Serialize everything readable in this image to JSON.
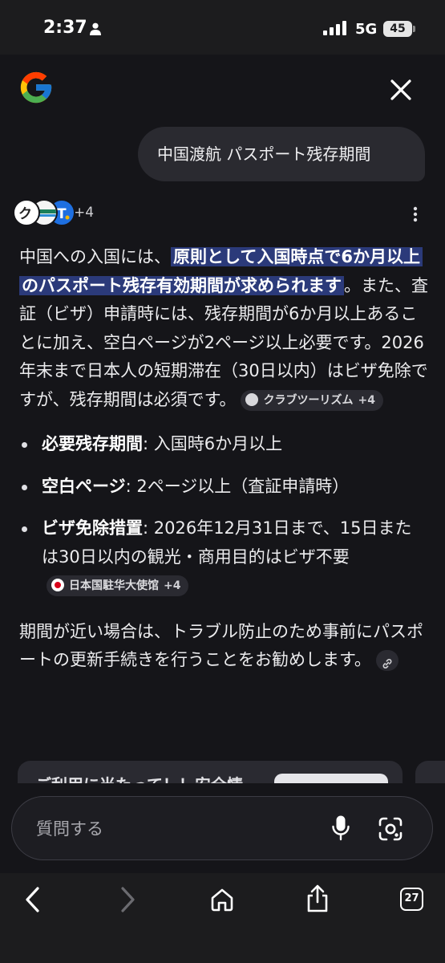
{
  "status_bar": {
    "time": "2:37",
    "network": "5G",
    "battery": "45"
  },
  "query": "中国渡航 パスポート残存期間",
  "sources": {
    "count_label": "+4",
    "icons": [
      "kura-ten-icon",
      "travel-site-icon",
      "t-site-icon"
    ]
  },
  "answer": {
    "intro_before": "中国への入国には、",
    "intro_highlight": "原則として入国時点で6か月以上のパスポート残存有効期間が求められます",
    "intro_after": "。また、査証（ビザ）申請時には、残存期間が6か月以上あることに加え、空白ページが2ページ以上必要です。2026年末まで日本人の短期滞在（30日以内）はビザ免除ですが、残存期間は必須です。",
    "intro_chip": {
      "label": "クラブツーリズム",
      "plus": "+4"
    },
    "bullets": [
      {
        "label": "必要残存期間",
        "text": ": 入国時6か月以上"
      },
      {
        "label": "空白ページ",
        "text": ": 2ページ以上（査証申請時）"
      },
      {
        "label": "ビザ免除措置",
        "text": ": 2026年12月31日まで、15日または30日以内の観光・商用目的はビザ不要"
      }
    ],
    "bullet_chip": {
      "label": "日本国駐华大使馆",
      "plus": "+4"
    },
    "closing": "期間が近い場合は、トラブル防止のため事前にパスポートの更新手続きを行うことをお勧めします。"
  },
  "card": {
    "title": "ご利用に当たって！！安全情"
  },
  "input": {
    "placeholder": "質問する"
  },
  "browser": {
    "tab_count": "27"
  },
  "colors": {
    "highlight": "#2b3a7a",
    "background": "#151519",
    "chip": "#2a2a31"
  }
}
